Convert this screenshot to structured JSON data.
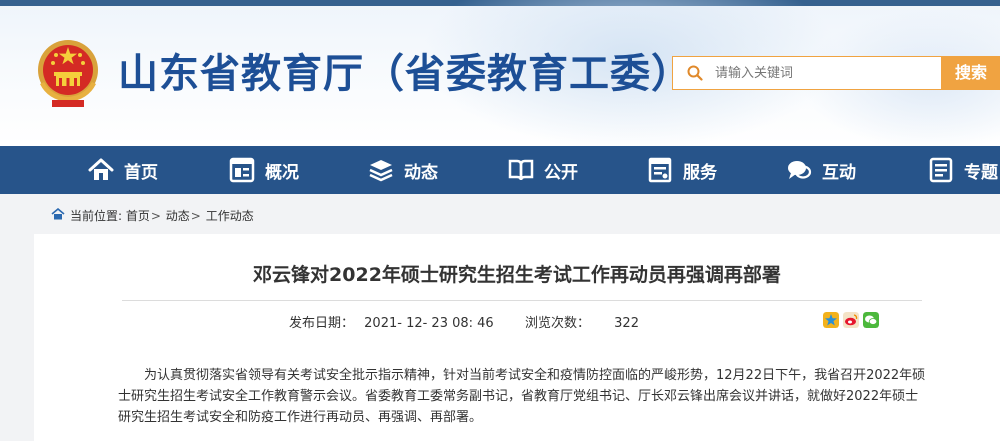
{
  "header": {
    "site_title": "山东省教育厅（省委教育工委）",
    "search_placeholder": "请输入关键词",
    "search_button": "搜索"
  },
  "nav": {
    "items": [
      {
        "label": "首页",
        "icon": "home-icon"
      },
      {
        "label": "概况",
        "icon": "overview-icon"
      },
      {
        "label": "动态",
        "icon": "news-stack-icon"
      },
      {
        "label": "公开",
        "icon": "open-book-icon"
      },
      {
        "label": "服务",
        "icon": "service-document-icon"
      },
      {
        "label": "互动",
        "icon": "chat-bubble-icon"
      },
      {
        "label": "专题",
        "icon": "topic-icon"
      }
    ]
  },
  "breadcrumb": {
    "prefix": "当前位置:",
    "items": [
      "首页",
      "动态",
      "工作动态"
    ],
    "separator": ">"
  },
  "article": {
    "title": "邓云锋对2022年硕士研究生招生考试工作再动员再强调再部署",
    "publish_label": "发布日期：",
    "publish_date": "2021- 12- 23 08: 46",
    "views_label": "浏览次数：",
    "views": "322",
    "share_icons": [
      "qzone-share-icon",
      "weibo-share-icon",
      "wechat-share-icon"
    ],
    "body": "为认真贯彻落实省领导有关考试安全批示指示精神，针对当前考试安全和疫情防控面临的严峻形势，12月22日下午，我省召开2022年硕士研究生招生考试安全工作教育警示会议。省委教育工委常务副书记，省教育厅党组书记、厅长邓云锋出席会议并讲话，就做好2022年硕士研究生招生考试安全和防疫工作进行再动员、再强调、再部署。"
  },
  "colors": {
    "brand_blue": "#1d4f96",
    "nav_blue": "#27548a",
    "search_orange": "#f0a341"
  }
}
